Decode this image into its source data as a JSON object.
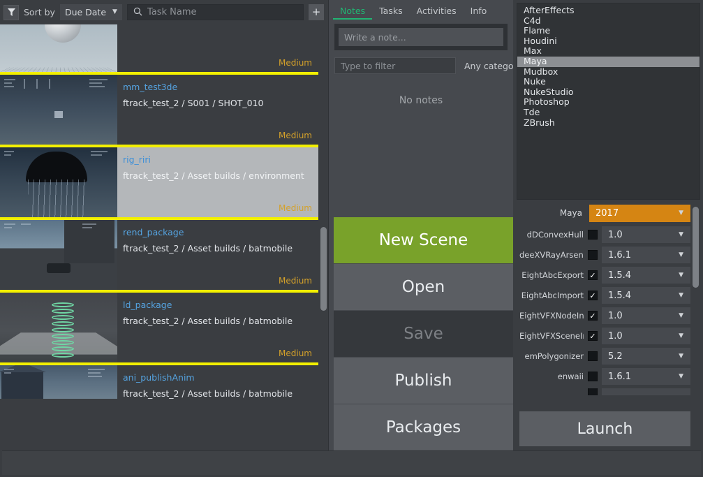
{
  "toolbar": {
    "filter_icon": "filter-icon",
    "sort_by_label": "Sort by",
    "sort_value": "Due Date",
    "search_icon": "search-icon",
    "search_value": "",
    "search_placeholder": "Task Name",
    "add_label": "+"
  },
  "tasks": [
    {
      "name": "",
      "path": "",
      "priority": "Medium",
      "selected": false,
      "art": "art-sphere",
      "cut": "top"
    },
    {
      "name": "mm_test3de",
      "path": "ftrack_test_2 / S001 / SHOT_010",
      "priority": "Medium",
      "selected": false,
      "art": "art-dark",
      "cut": "none"
    },
    {
      "name": "rig_riri",
      "path": "ftrack_test_2 / Asset builds / environment",
      "priority": "Medium",
      "selected": true,
      "art": "art-night",
      "cut": "none"
    },
    {
      "name": "rend_package",
      "path": "ftrack_test_2 / Asset builds / batmobile",
      "priority": "Medium",
      "selected": false,
      "art": "art-rend",
      "cut": "none"
    },
    {
      "name": "ld_package",
      "path": "ftrack_test_2 / Asset builds / batmobile",
      "priority": "Medium",
      "selected": false,
      "art": "art-spring",
      "cut": "none"
    },
    {
      "name": "ani_publishAnim",
      "path": "ftrack_test_2 / Asset builds / batmobile",
      "priority": "",
      "selected": false,
      "art": "art-house",
      "cut": "bottom"
    }
  ],
  "center": {
    "tabs": [
      {
        "label": "Notes",
        "active": true
      },
      {
        "label": "Tasks",
        "active": false
      },
      {
        "label": "Activities",
        "active": false
      },
      {
        "label": "Info",
        "active": false
      }
    ],
    "note_value": "",
    "note_placeholder": "Write a note...",
    "filter_value": "",
    "filter_placeholder": "Type to filter",
    "category_value": "Any category",
    "empty_notes_text": "No notes",
    "buttons": [
      {
        "label": "New Scene",
        "state": "primary"
      },
      {
        "label": "Open",
        "state": "normal"
      },
      {
        "label": "Save",
        "state": "disabled"
      },
      {
        "label": "Publish",
        "state": "normal"
      },
      {
        "label": "Packages",
        "state": "normal"
      }
    ]
  },
  "right": {
    "applications": [
      {
        "label": "AfterEffects",
        "selected": false
      },
      {
        "label": "C4d",
        "selected": false
      },
      {
        "label": "Flame",
        "selected": false
      },
      {
        "label": "Houdini",
        "selected": false
      },
      {
        "label": "Max",
        "selected": false
      },
      {
        "label": "Maya",
        "selected": true
      },
      {
        "label": "Mudbox",
        "selected": false
      },
      {
        "label": "Nuke",
        "selected": false
      },
      {
        "label": "NukeStudio",
        "selected": false
      },
      {
        "label": "Photoshop",
        "selected": false
      },
      {
        "label": "Tde",
        "selected": false
      },
      {
        "label": "ZBrush",
        "selected": false
      }
    ],
    "version_row": {
      "label": "Maya",
      "value": "2017"
    },
    "plugins": [
      {
        "label": "dDConvexHull",
        "checked": false,
        "version": "1.0"
      },
      {
        "label": "deeXVRayArsenal",
        "checked": false,
        "version": "1.6.1"
      },
      {
        "label": "EightAbcExport",
        "checked": true,
        "version": "1.5.4"
      },
      {
        "label": "EightAbcImport",
        "checked": true,
        "version": "1.5.4"
      },
      {
        "label": "EightVFXNodeInfo",
        "checked": true,
        "version": "1.0"
      },
      {
        "label": "EightVFXSceneInfo",
        "checked": true,
        "version": "1.0"
      },
      {
        "label": "emPolygonizer",
        "checked": false,
        "version": "5.2"
      },
      {
        "label": "enwaii",
        "checked": false,
        "version": "1.6.1"
      }
    ],
    "launch_label": "Launch"
  },
  "colors": {
    "accent_green": "#21b573",
    "primary_button": "#79a22a",
    "version_orange": "#d58513",
    "task_separator": "#f2ef00",
    "task_name_link": "#55a3e0",
    "priority_text": "#d4a12a",
    "selection_grey": "#8c8f93",
    "window_bg": "#3a3d41"
  },
  "statusbar": {
    "text": ""
  }
}
